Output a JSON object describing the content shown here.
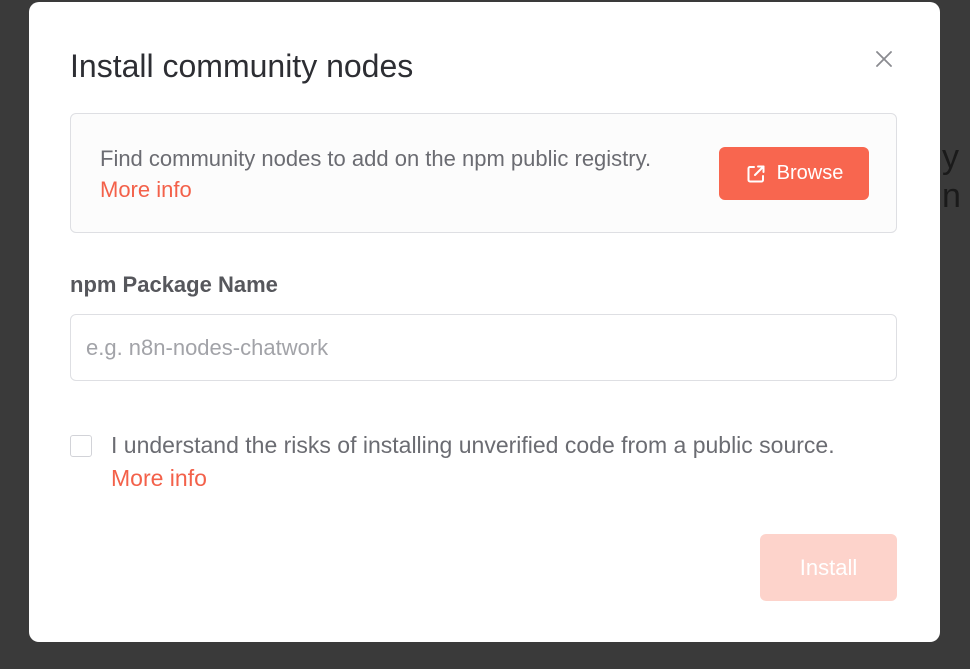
{
  "background": {
    "partial_text": "y n"
  },
  "modal": {
    "title": "Install community nodes",
    "close_icon": "close-icon",
    "info": {
      "text": "Find community nodes to add on the npm public registry. ",
      "link": "More info",
      "browse_label": "Browse",
      "browse_icon": "external-link-icon"
    },
    "package_field": {
      "label": "npm Package Name",
      "value": "",
      "placeholder": "e.g. n8n-nodes-chatwork"
    },
    "consent": {
      "checked": false,
      "text": "I understand the risks of installing unverified code from a public source.",
      "link": "More info"
    },
    "install_label": "Install",
    "install_disabled": true
  },
  "colors": {
    "accent": "#f8664f",
    "link": "#f3614a",
    "disabled_button": "#fdd3cb",
    "backdrop": "#3a3a3a"
  }
}
